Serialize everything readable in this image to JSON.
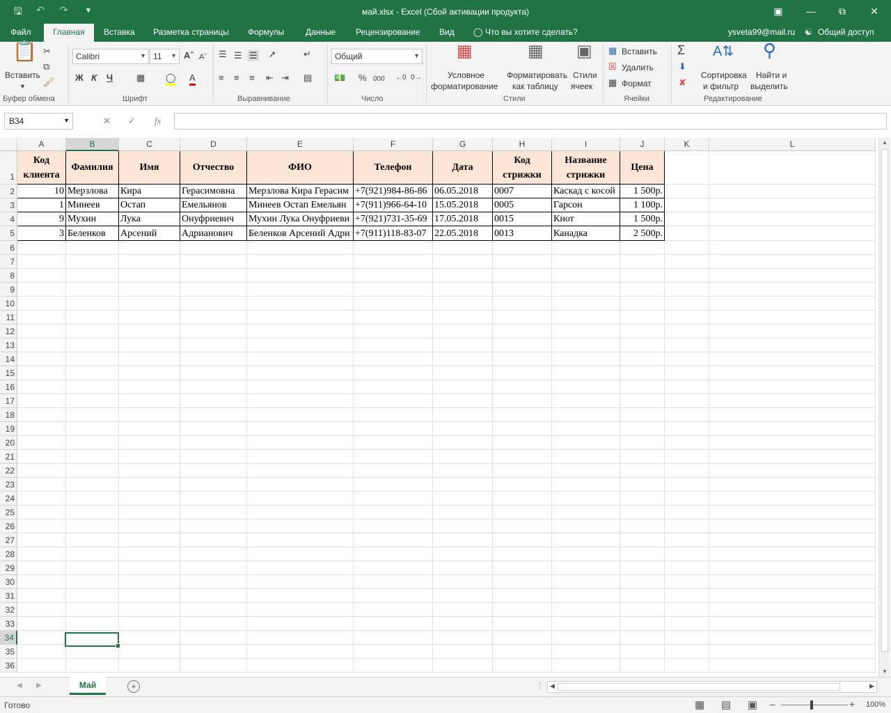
{
  "title": "май.xlsx - Excel (Сбой активации продукта)",
  "menu": {
    "file": "Файл",
    "tabs": [
      "Главная",
      "Вставка",
      "Разметка страницы",
      "Формулы",
      "Данные",
      "Рецензирование",
      "Вид"
    ],
    "tell_me": "Что вы хотите сделать?",
    "user": "ysveta99@mail.ru",
    "share": "Общий доступ"
  },
  "ribbon": {
    "paste": "Вставить",
    "font_name": "Calibri",
    "font_size": "11",
    "bold": "Ж",
    "italic": "К",
    "underline": "Ч",
    "number_format": "Общий",
    "percent": "%",
    "thousands": "000",
    "cond_format": [
      "Условное",
      "форматирование"
    ],
    "format_table": [
      "Форматировать",
      "как таблицу"
    ],
    "cell_styles": [
      "Стили",
      "ячеек"
    ],
    "insert": "Вставить",
    "delete": "Удалить",
    "format": "Формат",
    "sort": [
      "Сортировка",
      "и фильтр"
    ],
    "find": [
      "Найти и",
      "выделить"
    ],
    "groups": [
      "Буфер обмена",
      "Шрифт",
      "Выравнивание",
      "Число",
      "Стили",
      "Ячейки",
      "Редактирование"
    ]
  },
  "formula_bar": {
    "name_box": "B34",
    "fx": "fx",
    "value": ""
  },
  "columns": [
    "A",
    "B",
    "C",
    "D",
    "E",
    "F",
    "G",
    "H",
    "I",
    "J",
    "K",
    "L"
  ],
  "selected_column": "B",
  "selected_row": "34",
  "rows": [
    "1",
    "2",
    "3",
    "4",
    "5",
    "6",
    "7",
    "8",
    "9",
    "10",
    "11",
    "12",
    "13",
    "14",
    "15",
    "16",
    "17",
    "18",
    "19",
    "20",
    "21",
    "22",
    "23",
    "24",
    "25",
    "26",
    "27",
    "28",
    "29",
    "30",
    "31",
    "32",
    "33",
    "34",
    "35",
    "36"
  ],
  "table": {
    "headers": [
      "Код клиента",
      "Фамилия",
      "Имя",
      "Отчество",
      "ФИО",
      "Телефон",
      "Дата",
      "Код стрижки",
      "Название стрижки",
      "Цена"
    ],
    "data": [
      [
        "10",
        "Мерзлова",
        "Кира",
        "Герасимовна",
        "Мерзлова Кира Герасим",
        "+7(921)984-86-86",
        "06.05.2018",
        "0007",
        "Каскад с косой",
        "1 500р."
      ],
      [
        "1",
        "Минеев",
        "Остап",
        "Емельянов",
        "Минеев Остап Емельян",
        "+7(911)966-64-10",
        "15.05.2018",
        "0005",
        "Гарсон",
        "1 100р."
      ],
      [
        "9",
        "Мухин",
        "Лука",
        "Онуфриевич",
        "Мухин Лука Онуфриеви",
        "+7(921)731-35-69",
        "17.05.2018",
        "0015",
        "Кнот",
        "1 500р."
      ],
      [
        "3",
        "Беленков",
        "Арсений",
        "Адрианович",
        "Беленков Арсений Адри",
        "+7(911)118-83-07",
        "22.05.2018",
        "0013",
        "Канадка",
        "2 500р."
      ]
    ]
  },
  "sheet_tab": "Май",
  "status": "Готово",
  "zoom": "100%",
  "colors": {
    "accent": "#217346",
    "header_fill": "#fce4d6"
  }
}
